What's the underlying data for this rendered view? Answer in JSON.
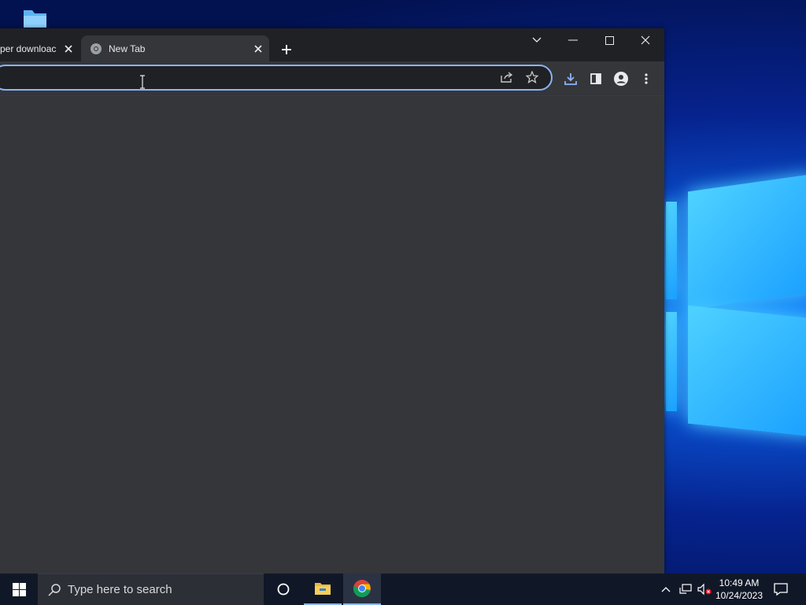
{
  "browser": {
    "tabs": [
      {
        "title": "per downloac",
        "active": false
      },
      {
        "title": "New Tab",
        "active": true
      }
    ],
    "new_tab_label": "+",
    "omnibox": {
      "value": "",
      "placeholder": ""
    }
  },
  "taskbar": {
    "search_placeholder": "Type here to search",
    "clock": {
      "time": "10:49 AM",
      "date": "10/24/2023"
    }
  },
  "colors": {
    "accent": "#8ab4f8",
    "browser_bg": "#35363a",
    "tabstrip_bg": "#202124",
    "taskbar_bg": "#101828"
  }
}
